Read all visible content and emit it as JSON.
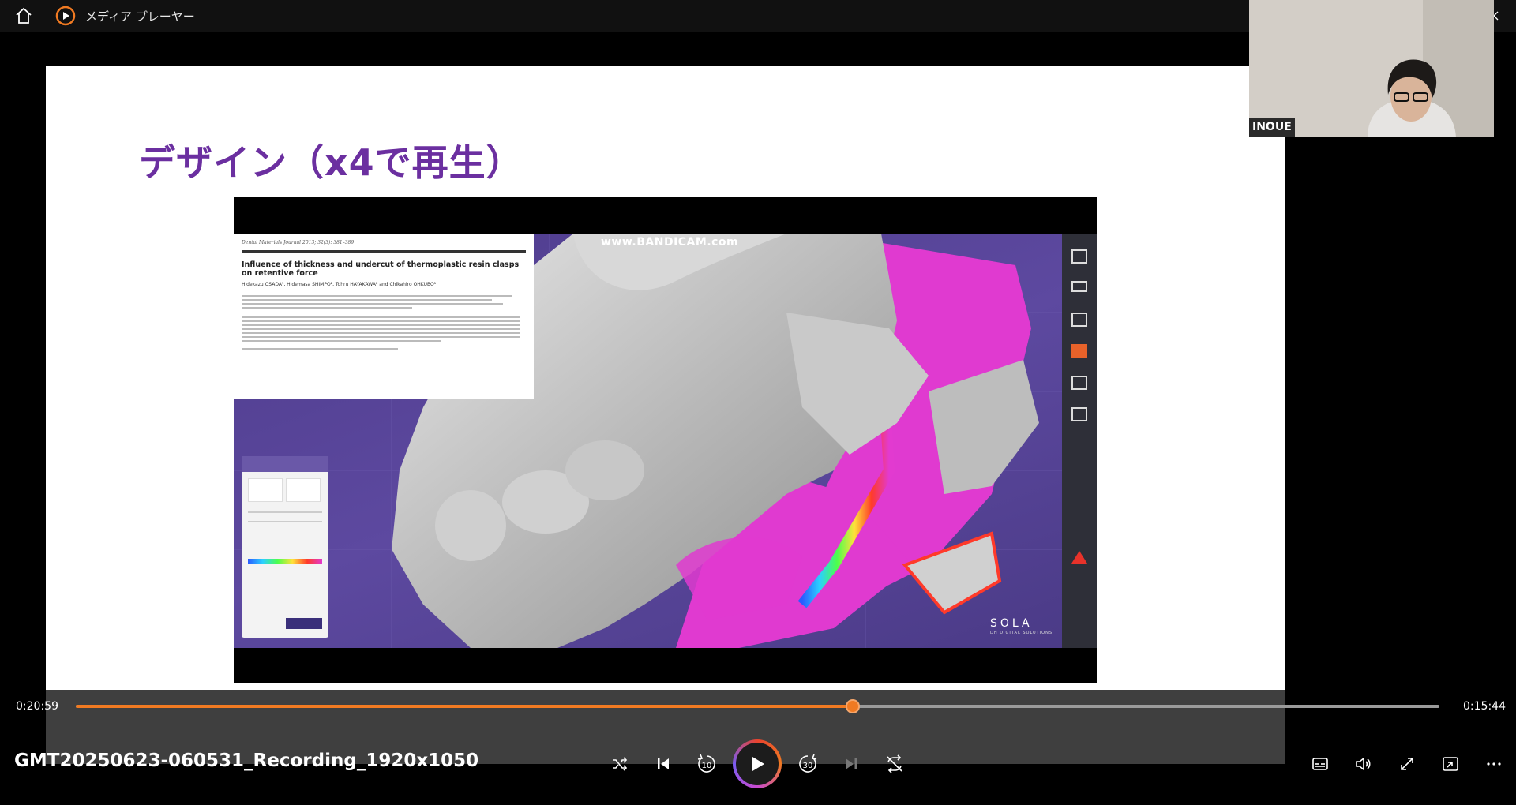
{
  "window": {
    "app_title": "メディア プレーヤー",
    "home_icon": "home-icon",
    "app_icon": "media-player-icon",
    "controls": [
      "minimize-icon",
      "restore-icon",
      "close-icon"
    ]
  },
  "slide": {
    "title": "デザイン（x4で再生）"
  },
  "embedded_video": {
    "watermark": "www.BANDICAM.com",
    "brand": "SOLA",
    "brand_sub": "DH DIGITAL SOLUTIONS",
    "paper": {
      "journal": "Dental Materials Journal 2013; 32(3): 381–389",
      "title": "Influence of thickness and undercut of thermoplastic resin clasps on retentive force",
      "authors": "Hidekazu OSADA¹, Hidemasa SHIMPO², Tohru HAYAKAWA² and Chikahiro OHKUBO¹"
    }
  },
  "webcam": {
    "participant_name": "INOUE"
  },
  "player": {
    "current_time": "0:20:59",
    "remaining_time": "0:15:44",
    "progress": 0.57,
    "filename": "GMT20250623-060531_Recording_1920x1050",
    "accent_color": "#f07a22",
    "buttons": {
      "shuffle": "shuffle-icon",
      "previous": "previous-icon",
      "rewind": "rewind-10-icon",
      "rewind_label": "10",
      "play": "play-icon",
      "forward": "forward-30-icon",
      "forward_label": "30",
      "next": "next-icon",
      "repeat": "repeat-icon",
      "subtitles": "subtitles-icon",
      "volume": "volume-icon",
      "fullscreen": "fullscreen-icon",
      "miniplayer": "miniplayer-icon",
      "more": "more-icon"
    }
  }
}
